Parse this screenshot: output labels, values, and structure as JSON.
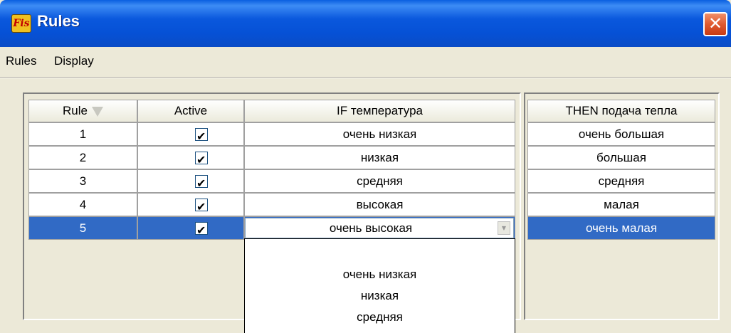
{
  "window": {
    "title": "Rules",
    "icon_text": "Fis",
    "close_glyph": "✕"
  },
  "menu": [
    {
      "label": "Rules"
    },
    {
      "label": "Display"
    }
  ],
  "table": {
    "headers": {
      "rule": "Rule",
      "active": "Active",
      "if": "IF температура",
      "then": "THEN подача тепла"
    },
    "rows": [
      {
        "rule": "1",
        "active": true,
        "if": "очень низкая",
        "then": "очень большая"
      },
      {
        "rule": "2",
        "active": true,
        "if": "низкая",
        "then": "большая"
      },
      {
        "rule": "3",
        "active": true,
        "if": "средняя",
        "then": "средняя"
      },
      {
        "rule": "4",
        "active": true,
        "if": "высокая",
        "then": "малая"
      },
      {
        "rule": "5",
        "active": true,
        "if": "очень высокая",
        "then": "очень малая",
        "selected": true
      }
    ]
  },
  "dropdown": {
    "selected": "очень высокая",
    "options": [
      "очень низкая",
      "низкая",
      "средняя"
    ]
  },
  "colors": {
    "selection": "#316ac5",
    "titlebar": "#0a58dd",
    "close": "#e05a30"
  }
}
